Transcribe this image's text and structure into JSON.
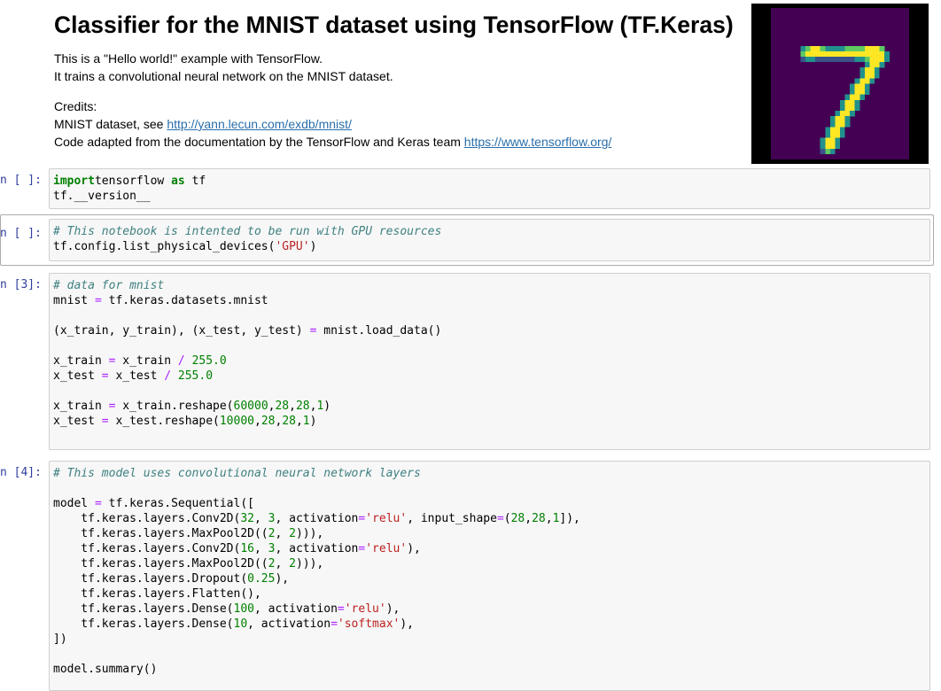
{
  "markdown": {
    "title": "Classifier for the MNIST dataset using TensorFlow (TF.Keras)",
    "intro_1": "This is a \"Hello world!\" example with TensorFlow.",
    "intro_2": "It trains a convolutional neural network on the MNIST dataset.",
    "credits_label": "Credits:",
    "mnist_prefix": "MNIST dataset, see ",
    "mnist_link": "http://yann.lecun.com/exdb/mnist/",
    "code_prefix": "Code adapted from the documentation by the TensorFlow and Keras team ",
    "tf_link": "https://www.tensorflow.org/"
  },
  "cells": [
    {
      "prompt": "n [ ]:",
      "lines": [
        [
          [
            "kw",
            "import"
          ],
          [
            "",
            "tensorflow "
          ],
          [
            "kw",
            "as"
          ],
          [
            "",
            " tf"
          ]
        ],
        [
          [
            "",
            "tf.__version__"
          ]
        ]
      ]
    },
    {
      "prompt": "n [ ]:",
      "lines": [
        [
          [
            "cm",
            "# This notebook is intented to be run with GPU resources"
          ]
        ],
        [
          [
            "",
            "tf.config.list_physical_devices("
          ],
          [
            "st",
            "'GPU'"
          ],
          [
            "",
            ")"
          ]
        ]
      ]
    },
    {
      "prompt": "n [3]:",
      "lines": [
        [
          [
            "cm",
            "# data for mnist"
          ]
        ],
        [
          [
            "",
            "mnist "
          ],
          [
            "op",
            "="
          ],
          [
            "",
            " tf.keras.datasets.mnist"
          ]
        ],
        [],
        [
          [
            "",
            "(x_train, y_train), (x_test, y_test) "
          ],
          [
            "op",
            "="
          ],
          [
            "",
            " mnist.load_data()"
          ]
        ],
        [],
        [
          [
            "",
            "x_train "
          ],
          [
            "op",
            "="
          ],
          [
            "",
            " x_train "
          ],
          [
            "op",
            "/"
          ],
          [
            "",
            " "
          ],
          [
            "nu",
            "255.0"
          ]
        ],
        [
          [
            "",
            "x_test "
          ],
          [
            "op",
            "="
          ],
          [
            "",
            " x_test "
          ],
          [
            "op",
            "/"
          ],
          [
            "",
            " "
          ],
          [
            "nu",
            "255.0"
          ]
        ],
        [],
        [
          [
            "",
            "x_train "
          ],
          [
            "op",
            "="
          ],
          [
            "",
            " x_train.reshape("
          ],
          [
            "nu",
            "60000"
          ],
          [
            "",
            ","
          ],
          [
            "nu",
            "28"
          ],
          [
            "",
            ","
          ],
          [
            "nu",
            "28"
          ],
          [
            "",
            ","
          ],
          [
            "nu",
            "1"
          ],
          [
            "",
            ")"
          ]
        ],
        [
          [
            "",
            "x_test "
          ],
          [
            "op",
            "="
          ],
          [
            "",
            " x_test.reshape("
          ],
          [
            "nu",
            "10000"
          ],
          [
            "",
            ","
          ],
          [
            "nu",
            "28"
          ],
          [
            "",
            ","
          ],
          [
            "nu",
            "28"
          ],
          [
            "",
            ","
          ],
          [
            "nu",
            "1"
          ],
          [
            "",
            ")"
          ]
        ],
        []
      ]
    },
    {
      "prompt": "n [4]:",
      "lines": [
        [
          [
            "cm",
            "# This model uses convolutional neural network layers"
          ]
        ],
        [],
        [
          [
            "",
            "model "
          ],
          [
            "op",
            "="
          ],
          [
            "",
            " tf.keras.Sequential(["
          ]
        ],
        [
          [
            "",
            "    tf.keras.layers.Conv2D("
          ],
          [
            "nu",
            "32"
          ],
          [
            "",
            ", "
          ],
          [
            "nu",
            "3"
          ],
          [
            "",
            ", activation"
          ],
          [
            "op",
            "="
          ],
          [
            "st",
            "'relu'"
          ],
          [
            "",
            ", input_shape"
          ],
          [
            "op",
            "="
          ],
          [
            "",
            "("
          ],
          [
            "nu",
            "28"
          ],
          [
            "",
            ","
          ],
          [
            "nu",
            "28"
          ],
          [
            "",
            ","
          ],
          [
            "nu",
            "1"
          ],
          [
            "",
            "]),"
          ]
        ],
        [
          [
            "",
            "    tf.keras.layers.MaxPool2D(("
          ],
          [
            "nu",
            "2"
          ],
          [
            "",
            ", "
          ],
          [
            "nu",
            "2"
          ],
          [
            "",
            "))),"
          ]
        ],
        [
          [
            "",
            "    tf.keras.layers.Conv2D("
          ],
          [
            "nu",
            "16"
          ],
          [
            "",
            ", "
          ],
          [
            "nu",
            "3"
          ],
          [
            "",
            ", activation"
          ],
          [
            "op",
            "="
          ],
          [
            "st",
            "'relu'"
          ],
          [
            "",
            "),"
          ]
        ],
        [
          [
            "",
            "    tf.keras.layers.MaxPool2D(("
          ],
          [
            "nu",
            "2"
          ],
          [
            "",
            ", "
          ],
          [
            "nu",
            "2"
          ],
          [
            "",
            "))),"
          ]
        ],
        [
          [
            "",
            "    tf.keras.layers.Dropout("
          ],
          [
            "nu",
            "0.25"
          ],
          [
            "",
            "),"
          ]
        ],
        [
          [
            "",
            "    tf.keras.layers.Flatten(),"
          ]
        ],
        [
          [
            "",
            "    tf.keras.layers.Dense("
          ],
          [
            "nu",
            "100"
          ],
          [
            "",
            ", activation"
          ],
          [
            "op",
            "="
          ],
          [
            "st",
            "'relu'"
          ],
          [
            "",
            "),"
          ]
        ],
        [
          [
            "",
            "    tf.keras.layers.Dense("
          ],
          [
            "nu",
            "10"
          ],
          [
            "",
            ", activation"
          ],
          [
            "op",
            "="
          ],
          [
            "st",
            "'softmax'"
          ],
          [
            "",
            "),"
          ]
        ],
        [
          [
            "",
            "])"
          ]
        ],
        [],
        [
          [
            "",
            "model.summary()"
          ]
        ]
      ]
    }
  ]
}
